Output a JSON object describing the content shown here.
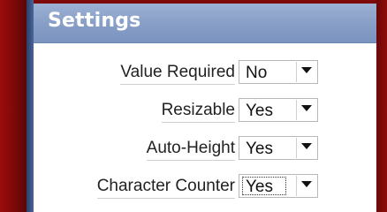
{
  "panel": {
    "title": "Settings"
  },
  "settings": [
    {
      "label": "Value Required",
      "value": "No"
    },
    {
      "label": "Resizable",
      "value": "Yes"
    },
    {
      "label": "Auto-Height",
      "value": "Yes"
    },
    {
      "label": "Character Counter",
      "value": "Yes"
    }
  ],
  "icons": {
    "dropdown": "chevron-down-icon"
  },
  "colors": {
    "header": "#889fc7",
    "frame": "#8a0a0a",
    "title_text": "#ffffff"
  }
}
